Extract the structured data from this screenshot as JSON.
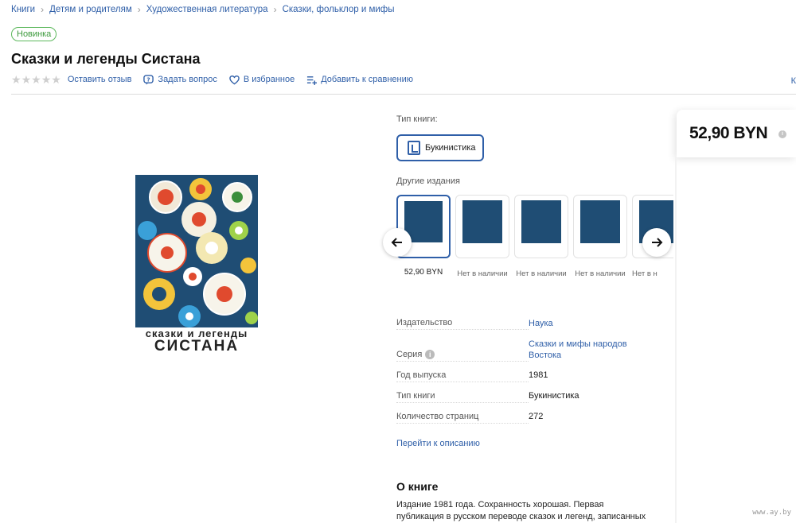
{
  "breadcrumb": [
    "Книги",
    "Детям и родителям",
    "Художественная литература",
    "Сказки, фольклор и мифы"
  ],
  "badge": "Новинка",
  "title": "Сказки и легенды Систана",
  "rating": {
    "value": 0,
    "max": 5
  },
  "actions": {
    "review": "Оставить отзыв",
    "question": "Задать вопрос",
    "favorite": "В избранное",
    "compare": "Добавить к сравнению"
  },
  "right_edge_text": "К",
  "cover": {
    "line1": "сказки и легенды",
    "line2": "СИСТАНА"
  },
  "book_type": {
    "label": "Тип книги:",
    "option": "Букинистика"
  },
  "editions": {
    "label": "Другие издания",
    "items": [
      {
        "status": "52,90 BYN",
        "selected": true
      },
      {
        "status": "Нет в наличии",
        "selected": false
      },
      {
        "status": "Нет в наличии",
        "selected": false
      },
      {
        "status": "Нет в наличии",
        "selected": false
      },
      {
        "status": "Нет в н",
        "selected": false
      }
    ]
  },
  "attributes": {
    "publisher": {
      "key": "Издательство",
      "value": "Наука"
    },
    "series": {
      "key": "Серия",
      "value": "Сказки и мифы народов Востока"
    },
    "year": {
      "key": "Год выпуска",
      "value": "1981"
    },
    "type": {
      "key": "Тип книги",
      "value": "Букинистика"
    },
    "pages": {
      "key": "Количество страниц",
      "value": "272"
    }
  },
  "goto_description": "Перейти к описанию",
  "about": {
    "title": "О книге",
    "text": "Издание 1981 года. Сохранность хорошая. Первая публикация в русском переводе сказок и легенд, записанных в районе г."
  },
  "price": "52,90 BYN",
  "watermark": "www.ay.by",
  "colors": {
    "link": "#2f5fa8",
    "badge": "#5cb85c",
    "cover_bg": "#1f4d74"
  }
}
